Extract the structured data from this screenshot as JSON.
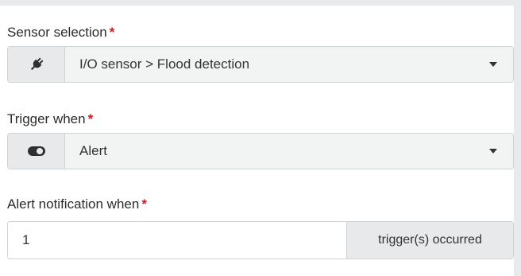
{
  "sensor_selection": {
    "label": "Sensor selection",
    "required_marker": "*",
    "icon": "plug-icon",
    "value": "I/O sensor > Flood detection"
  },
  "trigger_when": {
    "label": "Trigger when",
    "required_marker": "*",
    "icon": "toggle-icon",
    "value": "Alert"
  },
  "alert_notification": {
    "label": "Alert notification when",
    "required_marker": "*",
    "value": "1",
    "suffix": "trigger(s) occurred"
  },
  "colors": {
    "required": "#d9141b",
    "addon_background": "#e8e9ea",
    "border": "#cfd3d6"
  }
}
